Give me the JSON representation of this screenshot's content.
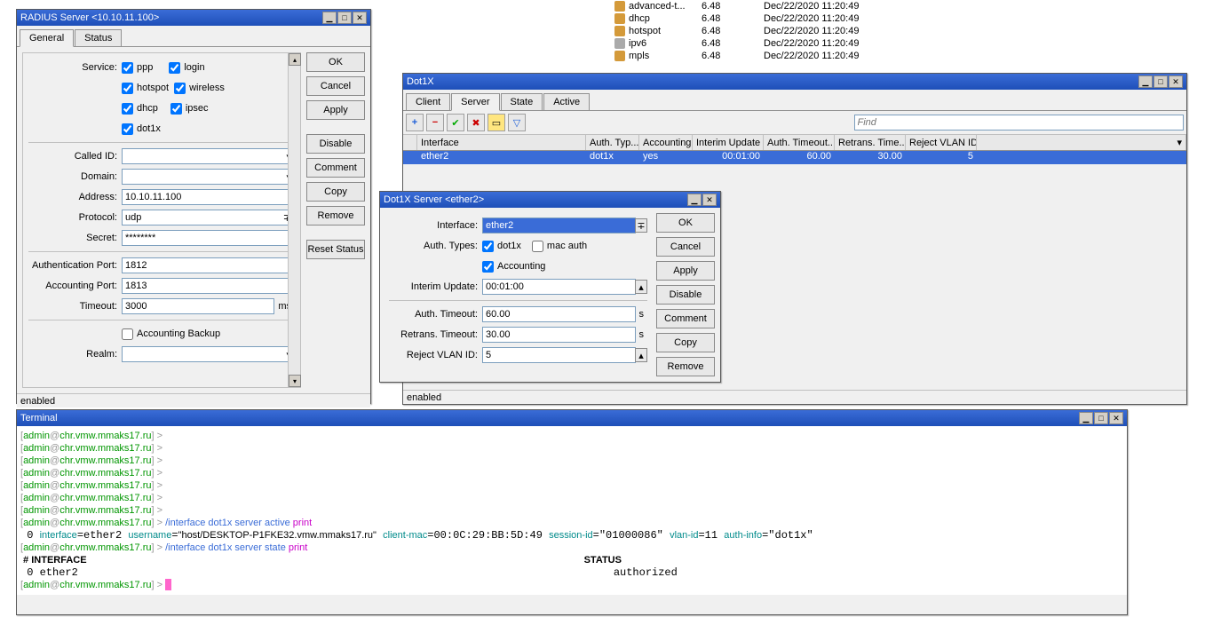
{
  "radius": {
    "title": "RADIUS Server <10.10.11.100>",
    "tabs": {
      "general": "General",
      "status": "Status"
    },
    "service_label": "Service:",
    "services": {
      "ppp": "ppp",
      "login": "login",
      "hotspot": "hotspot",
      "wireless": "wireless",
      "dhcp": "dhcp",
      "ipsec": "ipsec",
      "dot1x": "dot1x"
    },
    "called_id_label": "Called ID:",
    "domain_label": "Domain:",
    "address_label": "Address:",
    "address": "10.10.11.100",
    "protocol_label": "Protocol:",
    "protocol": "udp",
    "secret_label": "Secret:",
    "secret": "********",
    "auth_port_label": "Authentication Port:",
    "auth_port": "1812",
    "acct_port_label": "Accounting Port:",
    "acct_port": "1813",
    "timeout_label": "Timeout:",
    "timeout": "3000",
    "timeout_unit": "ms",
    "acct_backup": "Accounting Backup",
    "realm_label": "Realm:",
    "buttons": {
      "ok": "OK",
      "cancel": "Cancel",
      "apply": "Apply",
      "disable": "Disable",
      "comment": "Comment",
      "copy": "Copy",
      "remove": "Remove",
      "reset": "Reset Status"
    },
    "status": "enabled"
  },
  "pkgs": [
    {
      "name": "advanced-t...",
      "ver": "6.48",
      "date": "Dec/22/2020 11:20:49",
      "grey": false
    },
    {
      "name": "dhcp",
      "ver": "6.48",
      "date": "Dec/22/2020 11:20:49",
      "grey": false
    },
    {
      "name": "hotspot",
      "ver": "6.48",
      "date": "Dec/22/2020 11:20:49",
      "grey": false
    },
    {
      "name": "ipv6",
      "ver": "6.48",
      "date": "Dec/22/2020 11:20:49",
      "grey": true
    },
    {
      "name": "mpls",
      "ver": "6.48",
      "date": "Dec/22/2020 11:20:49",
      "grey": false
    }
  ],
  "dot1x": {
    "title": "Dot1X",
    "tabs": {
      "client": "Client",
      "server": "Server",
      "state": "State",
      "active": "Active"
    },
    "find_placeholder": "Find",
    "cols": {
      "iface": "Interface",
      "authtyp": "Auth. Typ...",
      "acct": "Accounting",
      "interim": "Interim Update",
      "authto": "Auth. Timeout...",
      "retrans": "Retrans. Time...",
      "reject": "Reject VLAN ID"
    },
    "row": {
      "iface": "ether2",
      "authtyp": "dot1x",
      "acct": "yes",
      "interim": "00:01:00",
      "authto": "60.00",
      "retrans": "30.00",
      "reject": "5"
    },
    "status": "enabled"
  },
  "dot1xserver": {
    "title": "Dot1X Server <ether2>",
    "iface_label": "Interface:",
    "iface": "ether2",
    "authtypes_label": "Auth. Types:",
    "dot1x": "dot1x",
    "mac": "mac auth",
    "acct": "Accounting",
    "interim_label": "Interim Update:",
    "interim": "00:01:00",
    "authto_label": "Auth. Timeout:",
    "authto": "60.00",
    "unit_s": "s",
    "retrans_label": "Retrans. Timeout:",
    "retrans": "30.00",
    "reject_label": "Reject VLAN ID:",
    "reject": "5",
    "buttons": {
      "ok": "OK",
      "cancel": "Cancel",
      "apply": "Apply",
      "disable": "Disable",
      "comment": "Comment",
      "copy": "Copy",
      "remove": "Remove"
    }
  },
  "terminal": {
    "title": "Terminal",
    "prompt_user": "admin",
    "prompt_host": "chr.vmw.mmaks17.ru",
    "cmd1": "/interface dot1x server active",
    "cmd1b": "print",
    "line0": "0 interface=",
    "iface": "ether2",
    " username": " username=",
    "uname": "\"host/DESKTOP-P1FKE32.vmw.mmaks17.ru\"",
    "cmac": " client-mac=",
    "mac": "00:0C:29:BB:5D:49",
    "sid": " session-id=",
    "sidv": "\"01000086\"",
    "vlan": " vlan-id=",
    "vlanv": "11",
    "ainfo": " auth-info=",
    "ainfov": "\"dot1x\"",
    "cmd2": "/interface dot1x server state",
    "cmd2b": "print",
    "hdr_iface": "# INTERFACE",
    "hdr_status": "STATUS",
    "r0": "0 ether2",
    "r0s": "authorized"
  }
}
